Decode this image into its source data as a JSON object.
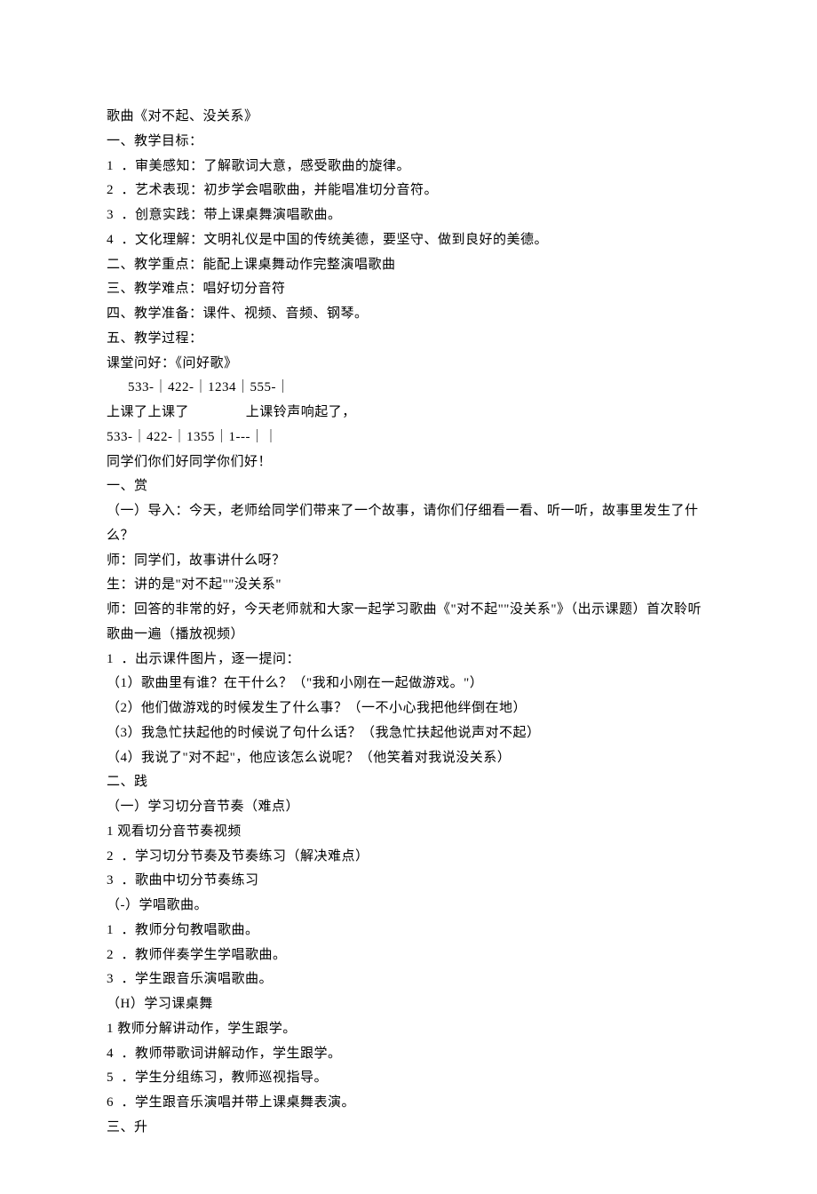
{
  "lines": [
    {
      "text": "歌曲《对不起、没关系》",
      "indent": false
    },
    {
      "text": "一、教学目标：",
      "indent": false
    },
    {
      "text": "1  ．审美感知：了解歌词大意，感受歌曲的旋律。",
      "indent": false
    },
    {
      "text": "2  ．艺术表现：初步学会唱歌曲，并能唱准切分音符。",
      "indent": false
    },
    {
      "text": "3  ．创意实践：带上课桌舞演唱歌曲。",
      "indent": false
    },
    {
      "text": "4  ．文化理解：文明礼仪是中国的传统美德，要坚守、做到良好的美德。",
      "indent": false
    },
    {
      "text": "二、教学重点：能配上课桌舞动作完整演唱歌曲",
      "indent": false
    },
    {
      "text": "三、教学难点：唱好切分音符",
      "indent": false
    },
    {
      "text": "四、教学准备：课件、视频、音频、钢琴。",
      "indent": false
    },
    {
      "text": "五、教学过程：",
      "indent": false
    },
    {
      "text": "课堂问好：《问好歌》",
      "indent": false
    },
    {
      "text": "533-｜422-｜1234｜555-｜",
      "indent": true
    },
    {
      "text": "上课了上课了               上课铃声响起了，",
      "indent": false
    },
    {
      "text": "533-｜422-｜1355｜1---｜｜",
      "indent": false
    },
    {
      "text": "同学们你们好同学你们好！",
      "indent": false
    },
    {
      "text": "一、赏",
      "indent": false
    },
    {
      "text": "（一）导入：今天，老师给同学们带来了一个故事，请你们仔细看一看、听一听，故事里发生了什么？",
      "indent": false
    },
    {
      "text": "师：同学们，故事讲什么呀？",
      "indent": false
    },
    {
      "text": "生：讲的是\"对不起\"\"没关系\"",
      "indent": false
    },
    {
      "text": "师：回答的非常的好，今天老师就和大家一起学习歌曲《\"对不起\"\"没关系\"》（出示课题）首次聆听歌曲一遍（播放视频）",
      "indent": false
    },
    {
      "text": "1  ．出示课件图片，逐一提问：",
      "indent": false
    },
    {
      "text": "（1）歌曲里有谁？在干什么？（\"我和小刚在一起做游戏。\"）",
      "indent": false
    },
    {
      "text": "（2）他们做游戏的时候发生了什么事？（一不小心我把他绊倒在地）",
      "indent": false
    },
    {
      "text": "（3）我急忙扶起他的时候说了句什么话？（我急忙扶起他说声对不起）",
      "indent": false
    },
    {
      "text": "（4）我说了\"对不起\"，他应该怎么说呢？（他笑着对我说没关系）",
      "indent": false
    },
    {
      "text": "二、践",
      "indent": false
    },
    {
      "text": "（一）学习切分音节奏（难点）",
      "indent": false
    },
    {
      "text": "1 观看切分音节奏视频",
      "indent": false
    },
    {
      "text": "2  ．学习切分节奏及节奏练习（解决难点）",
      "indent": false
    },
    {
      "text": "3  ．歌曲中切分节奏练习",
      "indent": false
    },
    {
      "text": "（-）学唱歌曲。",
      "indent": false
    },
    {
      "text": "1  ．教师分句教唱歌曲。",
      "indent": false
    },
    {
      "text": "2  ．教师伴奏学生学唱歌曲。",
      "indent": false
    },
    {
      "text": "3  ．学生跟音乐演唱歌曲。",
      "indent": false
    },
    {
      "text": "（H）学习课桌舞",
      "indent": false
    },
    {
      "text": "1 教师分解讲动作，学生跟学。",
      "indent": false
    },
    {
      "text": "4  ．教师带歌词讲解动作，学生跟学。",
      "indent": false
    },
    {
      "text": "5  ．学生分组练习，教师巡视指导。",
      "indent": false
    },
    {
      "text": "6  ．学生跟音乐演唱并带上课桌舞表演。",
      "indent": false
    },
    {
      "text": "三、升",
      "indent": false
    }
  ]
}
